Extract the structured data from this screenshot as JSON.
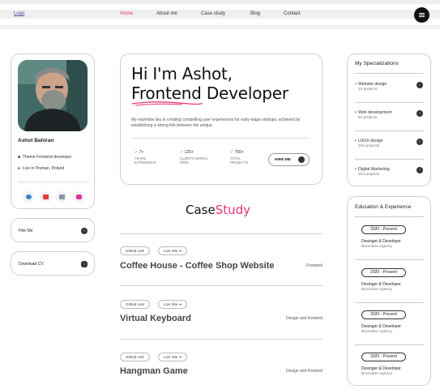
{
  "header": {
    "logo": "Logo",
    "nav": [
      "Home",
      "About me",
      "Case study",
      "Blog",
      "Contact"
    ],
    "active_nav": "Home"
  },
  "profile": {
    "name": "Ashot Bahiran",
    "theme": "Theme Frontend developer",
    "location": "Live in Poznan, Poland",
    "socials": [
      "telegram-icon",
      "youtube-icon",
      "mail-icon",
      "instagram-icon"
    ]
  },
  "sidebar": {
    "hire_label": "Hire Me",
    "cv_label": "Download CV"
  },
  "hero": {
    "greeting": "Hi I'm Ashot,",
    "role": "Frontend Developer",
    "description": "My expertise lies in creating compelling user experiences for early-stage startups, achieved by establishing a strong link between the unique.",
    "stats": [
      {
        "num": "7+",
        "label": "YEARS EXPERIENCE"
      },
      {
        "num": "125+",
        "label": "CLIENTS WORLD WIDE"
      },
      {
        "num": "750+",
        "label": "TOTAL PROJECTS"
      }
    ],
    "hire_label": "HIRE ME",
    "accent_color": "#ec2f79"
  },
  "case_study": {
    "title_part1": "Case",
    "title_part2": "Study",
    "projects": [
      {
        "github": "Github Link",
        "live": "Live Site",
        "title": "Coffee House - Coffee Shop Website",
        "category": "Frontend"
      },
      {
        "github": "Github Link",
        "live": "Live Site",
        "title": "Virtual Keyboard",
        "category": "Design and frontend"
      },
      {
        "github": "Github Link",
        "live": "Live Site",
        "title": "Hangman Game",
        "category": "Design and frontend"
      }
    ]
  },
  "specializations": {
    "title": "My Specializations",
    "items": [
      {
        "name": "Website design",
        "count": "24 projects"
      },
      {
        "name": "Web development",
        "count": "64 projects"
      },
      {
        "name": "UX/UI design",
        "count": "104 projects"
      },
      {
        "name": "Digital Marketing",
        "count": "204 projects"
      }
    ]
  },
  "education": {
    "title": "Education & Experience",
    "items": [
      {
        "period": "2020 - Present",
        "role": "Desinger & Developer",
        "org": "Brunodee Agency"
      },
      {
        "period": "2020 - Present",
        "role": "Desinger & Developer",
        "org": "Brunodee Agency"
      },
      {
        "period": "2020 - Present",
        "role": "Desinger & Developer",
        "org": "Brunodee Agency"
      },
      {
        "period": "2020 - Present",
        "role": "Desinger & Developer",
        "org": "Brunodee Agency"
      }
    ]
  }
}
